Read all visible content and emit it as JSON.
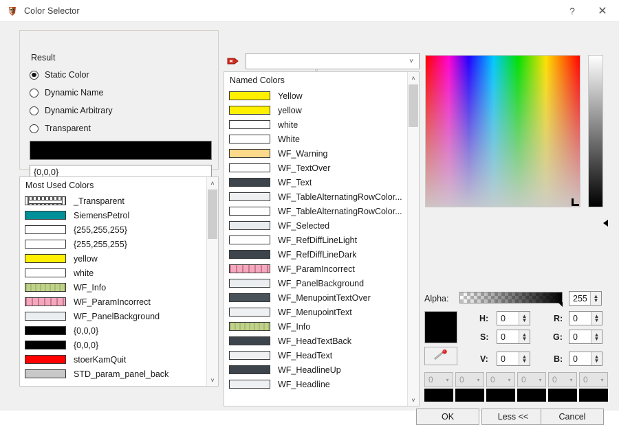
{
  "window": {
    "title": "Color Selector",
    "icon": "app-shield-icon",
    "help_label": "?",
    "close_label": "✕"
  },
  "result_group": {
    "legend": "Result",
    "options": [
      {
        "label": "Static Color",
        "selected": true
      },
      {
        "label": "Dynamic Name",
        "selected": false
      },
      {
        "label": "Dynamic Arbitrary",
        "selected": false
      },
      {
        "label": "Transparent",
        "selected": false
      }
    ],
    "preview_color": "#000000",
    "value_field": "{0,0,0}"
  },
  "most_used_colors": {
    "header": "Most Used Colors",
    "scroll": {
      "up_arrow": "˄",
      "down_arrow": "˅"
    },
    "items": [
      {
        "label": "_Transparent",
        "color": "transparent-pattern"
      },
      {
        "label": "SiemensPetrol",
        "color": "#009099"
      },
      {
        "label": "{255,255,255}",
        "color": "#ffffff"
      },
      {
        "label": "{255,255,255}",
        "color": "#ffffff"
      },
      {
        "label": "yellow",
        "color": "#fff000"
      },
      {
        "label": "white",
        "color": "#ffffff"
      },
      {
        "label": "WF_Info",
        "color": "#c0d28a"
      },
      {
        "label": "WF_ParamIncorrect",
        "color": "#f4a8bd"
      },
      {
        "label": "WF_PanelBackground",
        "color": "#eaeef1"
      },
      {
        "label": "{0,0,0}",
        "color": "#000000"
      },
      {
        "label": "{0,0,0}",
        "color": "#000000"
      },
      {
        "label": "stoerKamQuit",
        "color": "#ff0000"
      },
      {
        "label": "STD_param_panel_back",
        "color": "#c8c8c8"
      }
    ]
  },
  "name_combo": {
    "value": "",
    "placeholder": "",
    "arrow": "˅",
    "icon": "red-tag-delete-icon"
  },
  "named_colors": {
    "header": "Named Colors",
    "collapse_chevron": "˅",
    "scroll": {
      "up_arrow": "˄",
      "down_arrow": "˅"
    },
    "items": [
      {
        "label": "Yellow",
        "color": "#fff000"
      },
      {
        "label": "yellow",
        "color": "#fff000"
      },
      {
        "label": "white",
        "color": "#ffffff"
      },
      {
        "label": "White",
        "color": "#ffffff"
      },
      {
        "label": "WF_Warning",
        "color": "#fcd98a"
      },
      {
        "label": "WF_TextOver",
        "color": "#ffffff"
      },
      {
        "label": "WF_Text",
        "color": "#3d444b"
      },
      {
        "label": "WF_TableAlternatingRowColor...",
        "color": "#edeff1"
      },
      {
        "label": "WF_TableAlternatingRowColor...",
        "color": "#ffffff"
      },
      {
        "label": "WF_Selected",
        "color": "#e9ecef"
      },
      {
        "label": "WF_RefDiffLineLight",
        "color": "#ffffff"
      },
      {
        "label": "WF_RefDiffLineDark",
        "color": "#3d444b"
      },
      {
        "label": "WF_ParamIncorrect",
        "color": "#f4a8bd"
      },
      {
        "label": "WF_PanelBackground",
        "color": "#eaeef1"
      },
      {
        "label": "WF_MenupointTextOver",
        "color": "#4a525a"
      },
      {
        "label": "WF_MenupointText",
        "color": "#eef0f2"
      },
      {
        "label": "WF_Info",
        "color": "#c0d28a"
      },
      {
        "label": "WF_HeadTextBack",
        "color": "#3d444b"
      },
      {
        "label": "WF_HeadText",
        "color": "#eef0f2"
      },
      {
        "label": "WF_HeadlineUp",
        "color": "#3d444b"
      },
      {
        "label": "WF_Headline",
        "color": "#eef0f2"
      }
    ]
  },
  "picker": {
    "sv_field_name": "saturation-value-field",
    "value_slider_name": "value-slider",
    "marker_position": "bottom-right"
  },
  "channels": {
    "alpha_label": "Alpha:",
    "alpha_value": "255",
    "current_color": "#000000",
    "eyedropper_icon": "eyedropper-icon",
    "spin_up": "▲",
    "spin_down": "▼",
    "hsv": [
      {
        "label": "H:",
        "value": "0"
      },
      {
        "label": "S:",
        "value": "0"
      },
      {
        "label": "V:",
        "value": "0"
      }
    ],
    "rgb": [
      {
        "label": "R:",
        "value": "0"
      },
      {
        "label": "G:",
        "value": "0"
      },
      {
        "label": "B:",
        "value": "0"
      }
    ]
  },
  "palette_row": {
    "arrow": "▾",
    "slots": [
      {
        "value": "0",
        "color": "#000000"
      },
      {
        "value": "0",
        "color": "#000000"
      },
      {
        "value": "0",
        "color": "#000000"
      },
      {
        "value": "0",
        "color": "#000000"
      },
      {
        "value": "0",
        "color": "#000000"
      },
      {
        "value": "0",
        "color": "#000000"
      }
    ]
  },
  "buttons": {
    "ok": "OK",
    "less": "Less <<",
    "cancel": "Cancel"
  }
}
